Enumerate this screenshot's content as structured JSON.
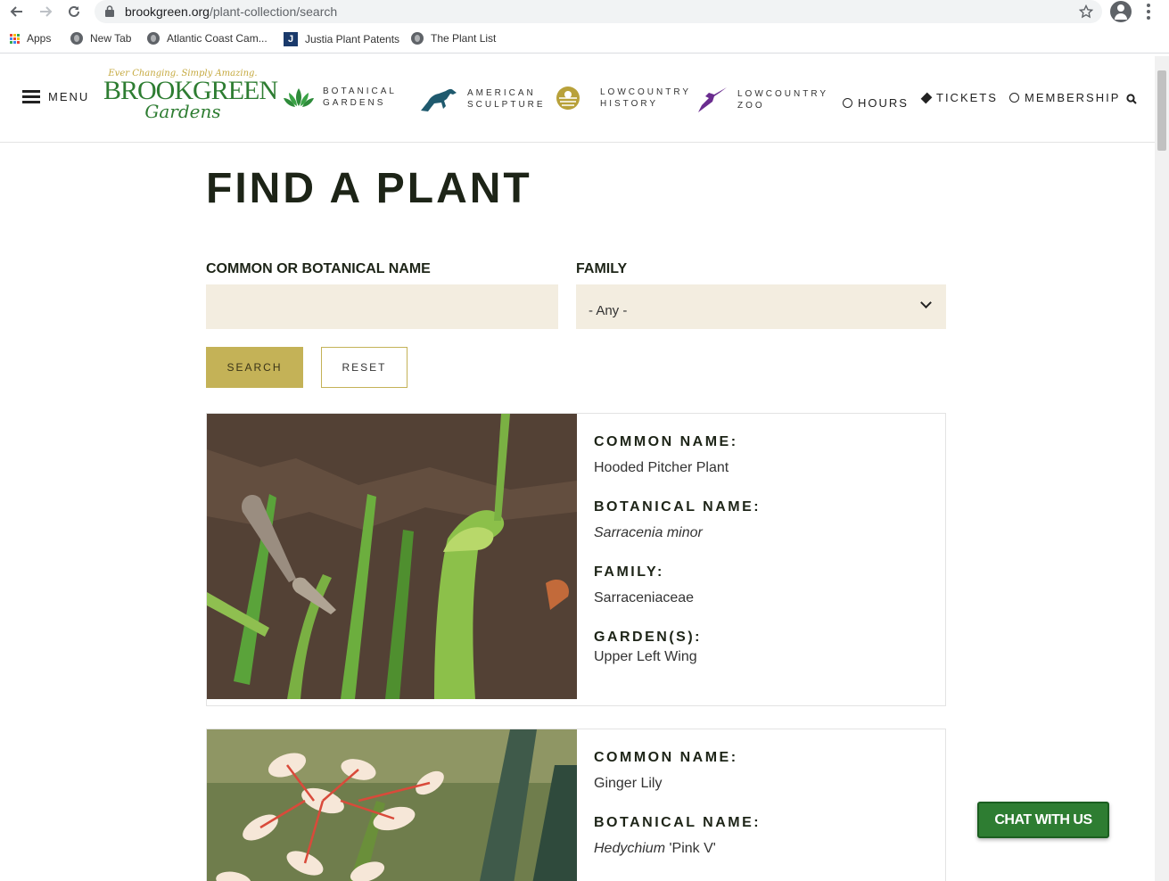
{
  "browser": {
    "url_host": "brookgreen.org",
    "url_path": "/plant-collection/search",
    "bookmarks": [
      {
        "label": "Apps",
        "icon": "apps-grid-icon"
      },
      {
        "label": "New Tab",
        "icon": "globe-icon"
      },
      {
        "label": "Atlantic Coast Cam...",
        "icon": "globe-icon"
      },
      {
        "label": "Justia Plant Patents",
        "icon": "justia-icon"
      },
      {
        "label": "The Plant List",
        "icon": "globe-icon"
      }
    ]
  },
  "header": {
    "menu_label": "MENU",
    "logo": {
      "tagline": "Ever Changing. Simply Amazing.",
      "line1": "BROOKGREEN",
      "line2": "Gardens"
    },
    "sections": [
      {
        "line1": "BOTANICAL",
        "line2": "GARDENS",
        "icon": "lotus-icon",
        "color": "#2e8b3a"
      },
      {
        "line1": "AMERICAN",
        "line2": "SCULPTURE",
        "icon": "horse-sculpture-icon",
        "color": "#1f5a6e"
      },
      {
        "line1": "LOWCOUNTRY",
        "line2": "HISTORY",
        "icon": "sun-field-icon",
        "color": "#b8a13a"
      },
      {
        "line1": "LOWCOUNTRY",
        "line2": "ZOO",
        "icon": "hummingbird-icon",
        "color": "#6a2c8f"
      }
    ],
    "links": {
      "hours": "HOURS",
      "tickets": "TICKETS",
      "membership": "MEMBERSHIP"
    }
  },
  "main": {
    "title": "FIND A PLANT",
    "name_label": "COMMON OR BOTANICAL NAME",
    "name_value": "",
    "family_label": "FAMILY",
    "family_value": "- Any -",
    "search_label": "SEARCH",
    "reset_label": "RESET"
  },
  "results": [
    {
      "common_head": "COMMON NAME:",
      "common": "Hooded Pitcher Plant",
      "botanical_head": "BOTANICAL NAME:",
      "botanical": "Sarracenia minor",
      "botanical_extra": "",
      "family_head": "FAMILY:",
      "family": "Sarraceniaceae",
      "garden_head": "GARDEN(S):",
      "garden": "Upper Left Wing"
    },
    {
      "common_head": "COMMON NAME:",
      "common": "Ginger Lily",
      "botanical_head": "BOTANICAL NAME:",
      "botanical": "Hedychium",
      "botanical_extra": " 'Pink V'"
    }
  ],
  "chat_label": "CHAT WITH US",
  "colors": {
    "accent_gold": "#c4b257",
    "input_bg": "#f3ede0",
    "brand_green": "#2e7d32"
  }
}
